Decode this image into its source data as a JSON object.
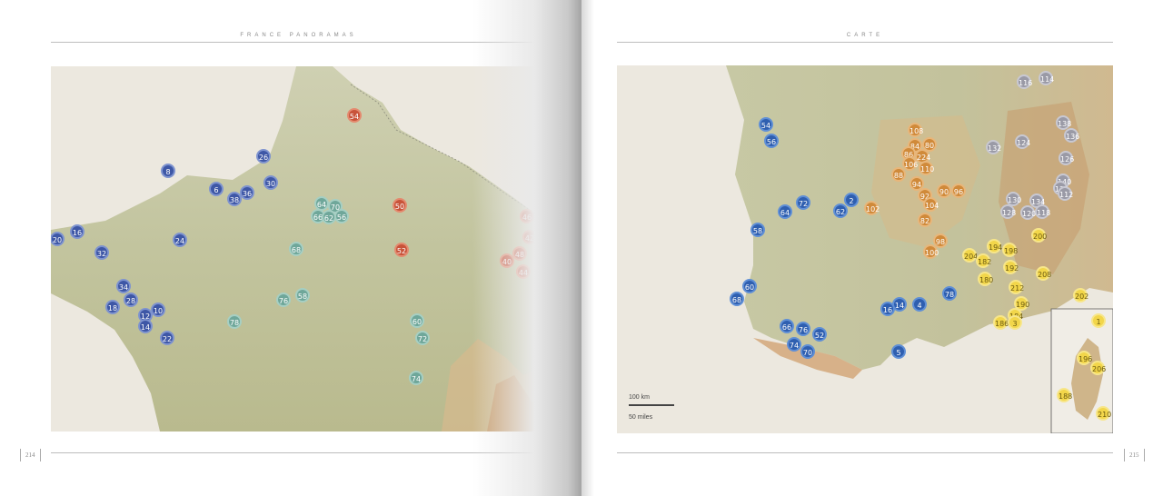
{
  "left_page": {
    "header": "FRANCE PANORAMAS",
    "page_number": "214",
    "markers": [
      {
        "label": "54",
        "color": "red"
      },
      {
        "label": "50",
        "color": "red"
      },
      {
        "label": "52",
        "color": "red"
      },
      {
        "label": "46",
        "color": "red"
      },
      {
        "label": "42",
        "color": "red"
      },
      {
        "label": "48",
        "color": "red"
      },
      {
        "label": "40",
        "color": "red"
      },
      {
        "label": "44",
        "color": "red"
      },
      {
        "label": "26",
        "color": "navy"
      },
      {
        "label": "8",
        "color": "navy"
      },
      {
        "label": "30",
        "color": "navy"
      },
      {
        "label": "6",
        "color": "navy"
      },
      {
        "label": "38",
        "color": "navy"
      },
      {
        "label": "36",
        "color": "navy"
      },
      {
        "label": "20",
        "color": "navy"
      },
      {
        "label": "16",
        "color": "navy"
      },
      {
        "label": "32",
        "color": "navy"
      },
      {
        "label": "24",
        "color": "navy"
      },
      {
        "label": "34",
        "color": "navy"
      },
      {
        "label": "28",
        "color": "navy"
      },
      {
        "label": "18",
        "color": "navy"
      },
      {
        "label": "12",
        "color": "navy"
      },
      {
        "label": "10",
        "color": "navy"
      },
      {
        "label": "14",
        "color": "navy"
      },
      {
        "label": "22",
        "color": "navy"
      },
      {
        "label": "64",
        "color": "teal"
      },
      {
        "label": "70",
        "color": "teal"
      },
      {
        "label": "66",
        "color": "teal"
      },
      {
        "label": "62",
        "color": "teal"
      },
      {
        "label": "56",
        "color": "teal"
      },
      {
        "label": "68",
        "color": "teal"
      },
      {
        "label": "76",
        "color": "teal"
      },
      {
        "label": "58",
        "color": "teal"
      },
      {
        "label": "78",
        "color": "teal"
      },
      {
        "label": "60",
        "color": "teal"
      },
      {
        "label": "72",
        "color": "teal"
      },
      {
        "label": "74",
        "color": "teal"
      }
    ]
  },
  "right_page": {
    "header": "CARTE",
    "page_number": "215",
    "scale_km": "100 km",
    "scale_miles": "50 miles",
    "markers": [
      {
        "label": "116",
        "color": "gray"
      },
      {
        "label": "114",
        "color": "gray"
      },
      {
        "label": "138",
        "color": "gray"
      },
      {
        "label": "136",
        "color": "gray"
      },
      {
        "label": "132",
        "color": "gray"
      },
      {
        "label": "124",
        "color": "gray"
      },
      {
        "label": "126",
        "color": "gray"
      },
      {
        "label": "140",
        "color": "gray"
      },
      {
        "label": "122",
        "color": "gray"
      },
      {
        "label": "112",
        "color": "gray"
      },
      {
        "label": "130",
        "color": "gray"
      },
      {
        "label": "134",
        "color": "gray"
      },
      {
        "label": "128",
        "color": "gray"
      },
      {
        "label": "120",
        "color": "gray"
      },
      {
        "label": "118",
        "color": "gray"
      },
      {
        "label": "108",
        "color": "orange"
      },
      {
        "label": "84",
        "color": "orange"
      },
      {
        "label": "80",
        "color": "orange"
      },
      {
        "label": "86",
        "color": "orange"
      },
      {
        "label": "224",
        "color": "orange"
      },
      {
        "label": "106",
        "color": "orange"
      },
      {
        "label": "110",
        "color": "orange"
      },
      {
        "label": "88",
        "color": "orange"
      },
      {
        "label": "94",
        "color": "orange"
      },
      {
        "label": "90",
        "color": "orange"
      },
      {
        "label": "96",
        "color": "orange"
      },
      {
        "label": "92",
        "color": "orange"
      },
      {
        "label": "104",
        "color": "orange"
      },
      {
        "label": "102",
        "color": "orange"
      },
      {
        "label": "82",
        "color": "orange"
      },
      {
        "label": "98",
        "color": "orange"
      },
      {
        "label": "100",
        "color": "orange"
      },
      {
        "label": "200",
        "color": "yellow"
      },
      {
        "label": "194",
        "color": "yellow"
      },
      {
        "label": "198",
        "color": "yellow"
      },
      {
        "label": "204",
        "color": "yellow"
      },
      {
        "label": "182",
        "color": "yellow"
      },
      {
        "label": "192",
        "color": "yellow"
      },
      {
        "label": "180",
        "color": "yellow"
      },
      {
        "label": "208",
        "color": "yellow"
      },
      {
        "label": "212",
        "color": "yellow"
      },
      {
        "label": "202",
        "color": "yellow"
      },
      {
        "label": "190",
        "color": "yellow"
      },
      {
        "label": "184",
        "color": "yellow"
      },
      {
        "label": "186",
        "color": "yellow"
      },
      {
        "label": "3",
        "color": "yellow"
      },
      {
        "label": "1",
        "color": "yellow"
      },
      {
        "label": "196",
        "color": "yellow"
      },
      {
        "label": "206",
        "color": "yellow"
      },
      {
        "label": "188",
        "color": "yellow"
      },
      {
        "label": "210",
        "color": "yellow"
      },
      {
        "label": "54",
        "color": "blue"
      },
      {
        "label": "56",
        "color": "blue"
      },
      {
        "label": "72",
        "color": "blue"
      },
      {
        "label": "2",
        "color": "blue"
      },
      {
        "label": "64",
        "color": "blue"
      },
      {
        "label": "62",
        "color": "blue"
      },
      {
        "label": "58",
        "color": "blue"
      },
      {
        "label": "60",
        "color": "blue"
      },
      {
        "label": "68",
        "color": "blue"
      },
      {
        "label": "14",
        "color": "blue"
      },
      {
        "label": "4",
        "color": "blue"
      },
      {
        "label": "16",
        "color": "blue"
      },
      {
        "label": "78",
        "color": "blue"
      },
      {
        "label": "66",
        "color": "blue"
      },
      {
        "label": "76",
        "color": "blue"
      },
      {
        "label": "74",
        "color": "blue"
      },
      {
        "label": "52",
        "color": "blue"
      },
      {
        "label": "70",
        "color": "blue"
      },
      {
        "label": "5",
        "color": "blue"
      }
    ]
  }
}
